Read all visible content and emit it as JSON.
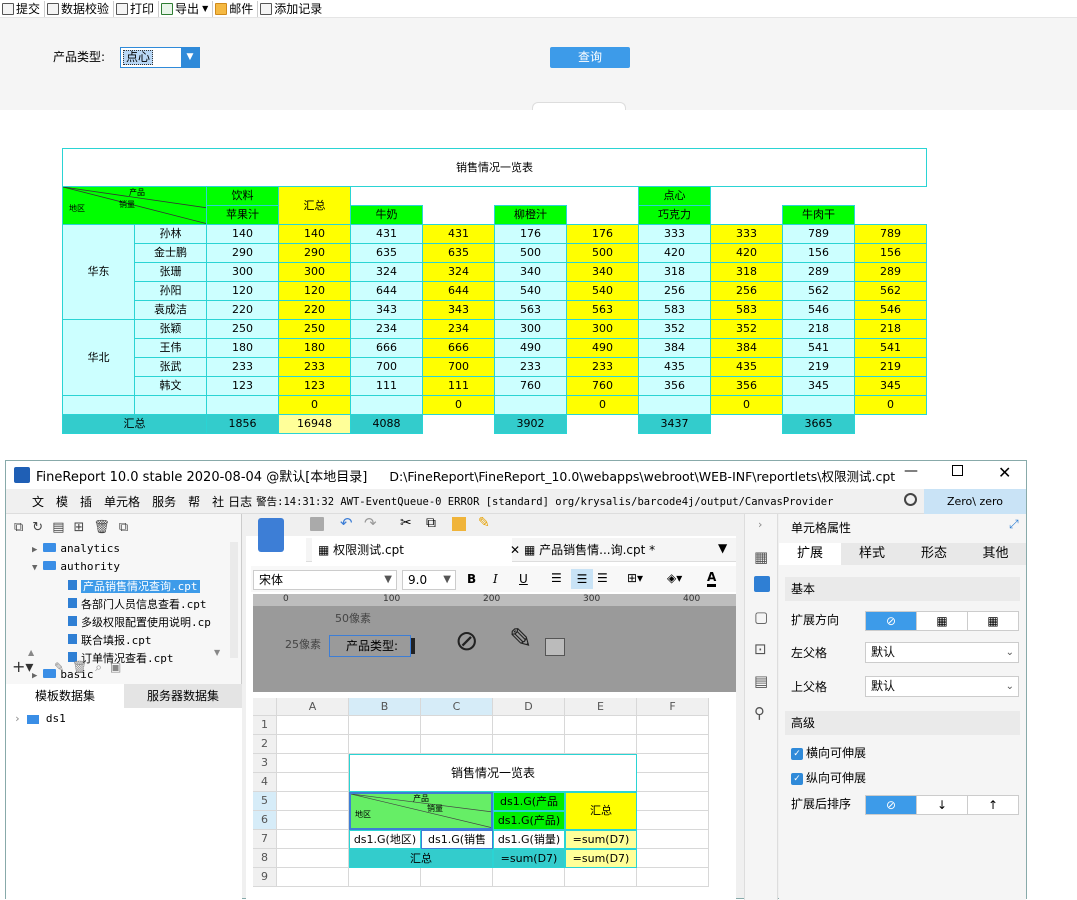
{
  "toolbar": {
    "items": [
      "提交",
      "数据校验",
      "打印",
      "导出",
      "邮件",
      "添加记录"
    ]
  },
  "param": {
    "label": "产品类型:",
    "value": "点心",
    "query": "查询"
  },
  "report": {
    "title": "销售情况一览表",
    "corner": {
      "top": "产品",
      "mid": "销量",
      "left": "地区"
    },
    "headers": {
      "drink": "饮料",
      "apple": "苹果汁",
      "total": "汇总",
      "milk": "牛奶",
      "orange": "柳橙汁",
      "snack": "点心",
      "choco": "巧克力",
      "beef": "牛肉干"
    },
    "regions": [
      "华东",
      "华北"
    ],
    "rows": [
      {
        "name": "孙林",
        "v": [
          "140",
          "140",
          "431",
          "431",
          "176",
          "176",
          "333",
          "333",
          "789",
          "789"
        ]
      },
      {
        "name": "金士鹏",
        "v": [
          "290",
          "290",
          "635",
          "635",
          "500",
          "500",
          "420",
          "420",
          "156",
          "156"
        ]
      },
      {
        "name": "张珊",
        "v": [
          "300",
          "300",
          "324",
          "324",
          "340",
          "340",
          "318",
          "318",
          "289",
          "289"
        ]
      },
      {
        "name": "孙阳",
        "v": [
          "120",
          "120",
          "644",
          "644",
          "540",
          "540",
          "256",
          "256",
          "562",
          "562"
        ]
      },
      {
        "name": "袁成洁",
        "v": [
          "220",
          "220",
          "343",
          "343",
          "563",
          "563",
          "583",
          "583",
          "546",
          "546"
        ]
      },
      {
        "name": "张颖",
        "v": [
          "250",
          "250",
          "234",
          "234",
          "300",
          "300",
          "352",
          "352",
          "218",
          "218"
        ]
      },
      {
        "name": "王伟",
        "v": [
          "180",
          "180",
          "666",
          "666",
          "490",
          "490",
          "384",
          "384",
          "541",
          "541"
        ]
      },
      {
        "name": "张武",
        "v": [
          "233",
          "233",
          "700",
          "700",
          "233",
          "233",
          "435",
          "435",
          "219",
          "219"
        ]
      },
      {
        "name": "韩文",
        "v": [
          "123",
          "123",
          "111",
          "111",
          "760",
          "760",
          "356",
          "356",
          "345",
          "345"
        ]
      }
    ],
    "zero_row": [
      "0",
      "0",
      "0",
      "0",
      "0"
    ],
    "summary": {
      "label": "汇总",
      "v": [
        "1856",
        "16948",
        "4088",
        "3902",
        "3437",
        "3665"
      ]
    }
  },
  "designer": {
    "title": "FineReport 10.0 stable 2020-08-04 @默认[本地目录]",
    "path": "D:\\FineReport\\FineReport_10.0\\webapps\\webroot\\WEB-INF\\reportlets\\权限测试.cpt",
    "menu": [
      "文",
      "模",
      "插",
      "单元格",
      "服务",
      "帮",
      "社",
      "日志",
      "警告:14:31:32 AWT-EventQueue-0 ERROR [standard] org/krysalis/barcode4j/output/CanvasProvider"
    ],
    "user": "Zero\\ zero",
    "tree": [
      {
        "label": "analytics",
        "kind": "folder"
      },
      {
        "label": "authority",
        "kind": "folder"
      },
      {
        "label": "产品销售情况查询.cpt",
        "kind": "file"
      },
      {
        "label": "各部门人员信息查看.cpt",
        "kind": "file"
      },
      {
        "label": "多级权限配置使用说明.cp",
        "kind": "file"
      },
      {
        "label": "联合填报.cpt",
        "kind": "file"
      },
      {
        "label": "订单情况查看.cpt",
        "kind": "file"
      },
      {
        "label": "basic",
        "kind": "folder"
      }
    ],
    "ds_tabs": [
      "模板数据集",
      "服务器数据集"
    ],
    "ds_item": "ds1",
    "tabs": [
      "权限测试.cpt",
      "产品销售情...询.cpt *"
    ],
    "font": "宋体",
    "font_size": "9.0",
    "ruler": [
      "0",
      "100",
      "200",
      "300",
      "400"
    ],
    "px_labels": [
      "50像素",
      "25像素"
    ],
    "param_label": "产品类型:",
    "col_headers": [
      "A",
      "B",
      "C",
      "D",
      "E",
      "F"
    ],
    "row_headers": [
      "1",
      "2",
      "3",
      "4",
      "5",
      "6",
      "7",
      "8",
      "9"
    ],
    "cells": {
      "title": "销售情况一览表",
      "d5": "ds1.G(产品",
      "d6": "ds1.G(产品)",
      "e5": "汇总",
      "b7": "ds1.G(地区)",
      "c7": "ds1.G(销售",
      "d7": "ds1.G(销量)",
      "e7": "=sum(D7)",
      "b8": "汇总",
      "d8": "=sum(D7)",
      "e8": "=sum(D7)",
      "corner_top": "产品",
      "corner_mid": "销量",
      "corner_left": "地区"
    },
    "props": {
      "title": "单元格属性",
      "tabs": [
        "扩展",
        "样式",
        "形态",
        "其他"
      ],
      "basic": "基本",
      "expand_dir": "扩展方向",
      "left_parent": "左父格",
      "upper_parent": "上父格",
      "default": "默认",
      "advanced": "高级",
      "h_stretch": "横向可伸展",
      "v_stretch": "纵向可伸展",
      "sort": "扩展后排序"
    }
  }
}
